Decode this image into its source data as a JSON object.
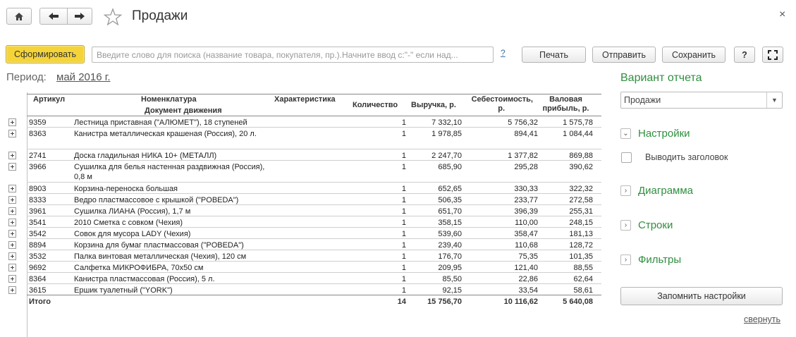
{
  "header": {
    "title": "Продажи",
    "close_label": "×",
    "nav_icons": [
      "home-icon",
      "back-arrow-icon",
      "forward-arrow-icon",
      "star-icon"
    ]
  },
  "toolbar": {
    "form_label": "Сформировать",
    "search_placeholder": "Введите слово для поиска (название товара, покупателя, пр.).Начните ввод с:\"-\" если над...",
    "help_link": "?",
    "print_label": "Печать",
    "send_label": "Отправить",
    "save_label": "Сохранить",
    "help_label": "?"
  },
  "period": {
    "label": "Период:",
    "value": "май 2016 г."
  },
  "report": {
    "columns": {
      "article": "Артикул",
      "nomenclature": "Номенклатура",
      "characteristic": "Характеристика",
      "document": "Документ движения",
      "quantity": "Количество",
      "revenue": "Выручка, р.",
      "cost_1": "Себестоимость,",
      "cost_2": "р.",
      "gross_1": "Валовая",
      "gross_2": "прибыль, р."
    },
    "rows": [
      {
        "article": "9359",
        "name": "Лестница приставная (\"АЛЮМЕТ\"), 18 ступеней",
        "qty": "1",
        "revenue": "7 332,10",
        "cost": "5 756,32",
        "gross": "1 575,78"
      },
      {
        "article": "8363",
        "name": "Канистра металлическая крашеная (Россия), 20 л.",
        "qty": "1",
        "revenue": "1 978,85",
        "cost": "894,41",
        "gross": "1 084,44"
      },
      {
        "article": "2741",
        "name": "Доска гладильная  НИКА 10+ (МЕТАЛЛ)",
        "qty": "1",
        "revenue": "2 247,70",
        "cost": "1 377,82",
        "gross": "869,88"
      },
      {
        "article": "3966",
        "name": "Сушилка для белья настенная раздвижная (Россия), 0,8 м",
        "qty": "1",
        "revenue": "685,90",
        "cost": "295,28",
        "gross": "390,62"
      },
      {
        "article": "8903",
        "name": "Корзина-переноска большая",
        "qty": "1",
        "revenue": "652,65",
        "cost": "330,33",
        "gross": "322,32"
      },
      {
        "article": "8333",
        "name": "Ведро пластмассовое с крышкой (\"POBEDA\")",
        "qty": "1",
        "revenue": "506,35",
        "cost": "233,77",
        "gross": "272,58"
      },
      {
        "article": "3961",
        "name": "Сушилка ЛИАНА (Россия), 1,7 м",
        "qty": "1",
        "revenue": "651,70",
        "cost": "396,39",
        "gross": "255,31"
      },
      {
        "article": "3541",
        "name": "2010 Сметка с совком (Чехия)",
        "qty": "1",
        "revenue": "358,15",
        "cost": "110,00",
        "gross": "248,15"
      },
      {
        "article": "3542",
        "name": "Совок для мусора LADY (Чехия)",
        "qty": "1",
        "revenue": "539,60",
        "cost": "358,47",
        "gross": "181,13"
      },
      {
        "article": "8894",
        "name": "Корзина для бумаг пластмассовая (\"POBEDA\")",
        "qty": "1",
        "revenue": "239,40",
        "cost": "110,68",
        "gross": "128,72"
      },
      {
        "article": "3532",
        "name": "Палка винтовая металлическая (Чехия), 120 см",
        "qty": "1",
        "revenue": "176,70",
        "cost": "75,35",
        "gross": "101,35"
      },
      {
        "article": "9692",
        "name": "Салфетка МИКРОФИБРА, 70х50 см",
        "qty": "1",
        "revenue": "209,95",
        "cost": "121,40",
        "gross": "88,55"
      },
      {
        "article": "8364",
        "name": "Канистра пластмассовая (Россия), 5 л.",
        "qty": "1",
        "revenue": "85,50",
        "cost": "22,86",
        "gross": "62,64"
      },
      {
        "article": "3615",
        "name": "Ершик туалетный (\"YORK\")",
        "qty": "1",
        "revenue": "92,15",
        "cost": "33,54",
        "gross": "58,61"
      }
    ],
    "total": {
      "label": "Итого",
      "qty": "14",
      "revenue": "15 756,70",
      "cost": "10 116,62",
      "gross": "5 640,08"
    }
  },
  "panel": {
    "variant_title": "Вариант отчета",
    "variant_value": "Продажи",
    "settings": "Настройки",
    "show_header": "Выводить заголовок",
    "diagram": "Диаграмма",
    "rows": "Строки",
    "filters": "Фильтры",
    "remember": "Запомнить настройки",
    "collapse": "свернуть"
  },
  "colors": {
    "accent_green": "#2f8f3f",
    "primary_button": "#f5d43a",
    "link_blue": "#3c6ea8"
  }
}
